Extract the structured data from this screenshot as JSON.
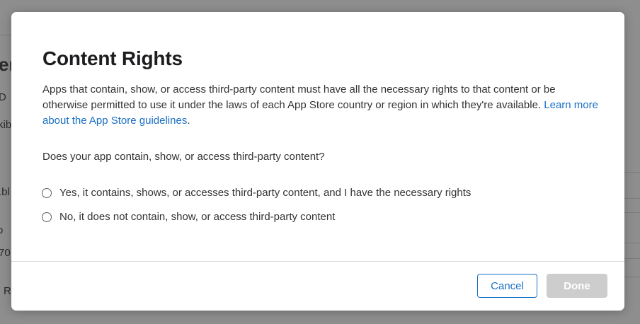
{
  "background": {
    "fragments": [
      "er",
      "D",
      "kib",
      ".bl",
      "o",
      "70",
      "R"
    ],
    "top_text": "r ... / / ... r ... / /"
  },
  "dialog": {
    "title": "Content Rights",
    "description": "Apps that contain, show, or access third-party content must have all the necessary rights to that content or be otherwise permitted to use it under the laws of each App Store country or region in which they're available.",
    "link": "Learn more about the App Store guidelines",
    "link_suffix": ".",
    "question": "Does your app contain, show, or access third-party content?",
    "options": [
      {
        "label": "Yes, it contains, shows, or accesses third-party content, and I have the necessary rights",
        "selected": false
      },
      {
        "label": "No, it does not contain, show, or access third-party content",
        "selected": false
      }
    ],
    "buttons": {
      "cancel": "Cancel",
      "done": "Done",
      "done_enabled": false
    }
  },
  "colors": {
    "accent": "#1a6fc4",
    "disabled_button": "#cdcdcd",
    "overlay": "#8e8e8e"
  }
}
